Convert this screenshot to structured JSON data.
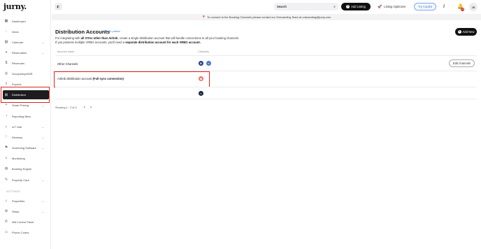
{
  "app": {
    "logo": "jurny."
  },
  "sidebar": {
    "items": [
      {
        "label": "Dashboard",
        "icon": "grid-icon",
        "glyph": "▦"
      },
      {
        "label": "Inbox",
        "icon": "chat-icon",
        "glyph": "◌"
      },
      {
        "label": "Calendar",
        "icon": "calendar-icon",
        "glyph": "▤",
        "chevron": "⌄"
      },
      {
        "label": "Reservation",
        "icon": "pin-icon",
        "glyph": "⌖",
        "chevron": "⌄"
      },
      {
        "label": "Revenues",
        "icon": "dollar-icon",
        "glyph": "$"
      },
      {
        "label": "Occupancy/ADR",
        "icon": "check-circle-icon",
        "glyph": "◎"
      },
      {
        "label": "Exports",
        "icon": "export-icon",
        "glyph": "⇪"
      },
      {
        "label": "Distribution",
        "icon": "distribution-icon",
        "glyph": "⊞",
        "active": true
      },
      {
        "label": "Smart Pricing",
        "icon": "pricing-icon",
        "glyph": "✧",
        "chevron": "⌄"
      },
      {
        "label": "Reporting Beta",
        "icon": "report-icon",
        "glyph": "◔"
      },
      {
        "label": "IoT Hub",
        "icon": "iot-icon",
        "glyph": "⌂",
        "chevron": "⌄"
      },
      {
        "label": "Reviews",
        "icon": "heart-icon",
        "glyph": "♡",
        "chevron": "⌄"
      },
      {
        "label": "Screening Software",
        "icon": "flag-icon",
        "glyph": "⚑",
        "chevron": "⌄"
      },
      {
        "label": "Monitoring",
        "icon": "search-icon",
        "glyph": "⌕"
      },
      {
        "label": "Booking Engine",
        "icon": "globe-icon",
        "glyph": "◍"
      },
      {
        "label": "Property Care",
        "icon": "tools-icon",
        "glyph": "✎",
        "chevron": "⌄"
      }
    ],
    "settings_heading": "SETTINGS",
    "settings_items": [
      {
        "label": "Properties",
        "icon": "home-icon",
        "glyph": "⌂",
        "chevron": "⌄"
      },
      {
        "label": "Setup",
        "icon": "gear-icon",
        "glyph": "⚙",
        "chevron": "⌄"
      },
      {
        "label": "WA Control Panel",
        "icon": "whatsapp-icon",
        "glyph": "✆"
      },
      {
        "label": "Promo Codes",
        "icon": "ticket-icon",
        "glyph": "▭"
      }
    ]
  },
  "topbar": {
    "collapse_glyph": "◧",
    "search_value": "Search",
    "search_icon": "⌕",
    "add_listing": "Add Listing",
    "listing_optimizer": "Listing Optimizer",
    "try_copilot": "Try Copilot",
    "info_glyph": "i",
    "bell_glyph": "🔔",
    "notif_count": "10",
    "avatar_initials": "JS"
  },
  "banner": {
    "pin_glyph": "📍",
    "text": "To connect to the Booking Channels please contact our Onboarding Team at onboarding@jurny.com"
  },
  "header": {
    "title": "Distribution Accounts",
    "create_pattern": "Create pattern",
    "desc_line1_a": "For integrating with ",
    "desc_line1_b": "all OTAs other than Airbnb",
    "desc_line1_c": ", create a single distribution account that will handle connections to all your booking channels.",
    "desc_line2_a": "If you possess multiple VRBO accounts, you'll need a ",
    "desc_line2_b": "separate distribution account for each VRBO account.",
    "add_new": "Add New"
  },
  "table": {
    "headers": {
      "account_name": "Account name",
      "channels": "Channels"
    },
    "rows": [
      {
        "account_name": "Other Channels",
        "action": "Edit channels"
      },
      {
        "account_name_a": "Airbnb distribution account ",
        "account_name_b": "(Full sync connection)"
      },
      {
        "account_name": ""
      }
    ],
    "colors": {
      "booking": "#1d3f87",
      "expedia": "#4a79c9",
      "airbnb": "#f0766e",
      "vrbo": "#1f2a44"
    },
    "channel_glyphs": {
      "booking": "B",
      "expedia": "⌁",
      "airbnb": "◈",
      "vrbo": "◐"
    }
  },
  "pagination": {
    "text": "Showing 1 - 3 of 3",
    "prev": "‹",
    "next": "›"
  }
}
